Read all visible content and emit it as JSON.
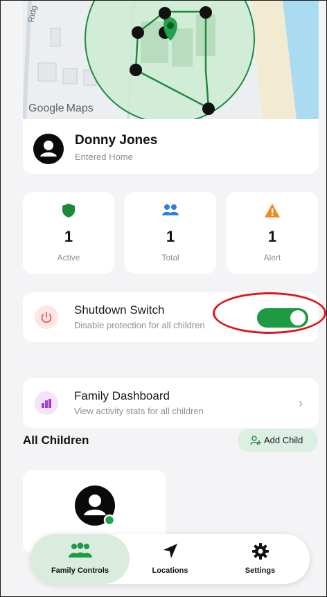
{
  "map": {
    "street_label": "Ridg",
    "attribution_google": "Google",
    "attribution_maps": "Maps"
  },
  "user": {
    "name": "Donny Jones",
    "status": "Entered Home"
  },
  "stats": [
    {
      "value": "1",
      "label": "Active",
      "icon": "shield-icon",
      "color": "#1d8a3a"
    },
    {
      "value": "1",
      "label": "Total",
      "icon": "people-icon",
      "color": "#2a7fe0"
    },
    {
      "value": "1",
      "label": "Alert",
      "icon": "warning-icon",
      "color": "#f08a1d"
    }
  ],
  "shutdown": {
    "title": "Shutdown Switch",
    "subtitle": "Disable protection for all children",
    "enabled": true,
    "toggle_color": "#1c9a44"
  },
  "dashboard": {
    "title": "Family Dashboard",
    "subtitle": "View activity stats for all children",
    "chevron": "›"
  },
  "children": {
    "section_title": "All Children",
    "add_label": "Add Child"
  },
  "nav": [
    {
      "label": "Family Controls",
      "icon": "family-icon",
      "active": true
    },
    {
      "label": "Locations",
      "icon": "location-arrow-icon",
      "active": false
    },
    {
      "label": "Settings",
      "icon": "gear-icon",
      "active": false
    }
  ],
  "colors": {
    "accent_green": "#1c9a44",
    "highlight_red": "#e0141b"
  }
}
